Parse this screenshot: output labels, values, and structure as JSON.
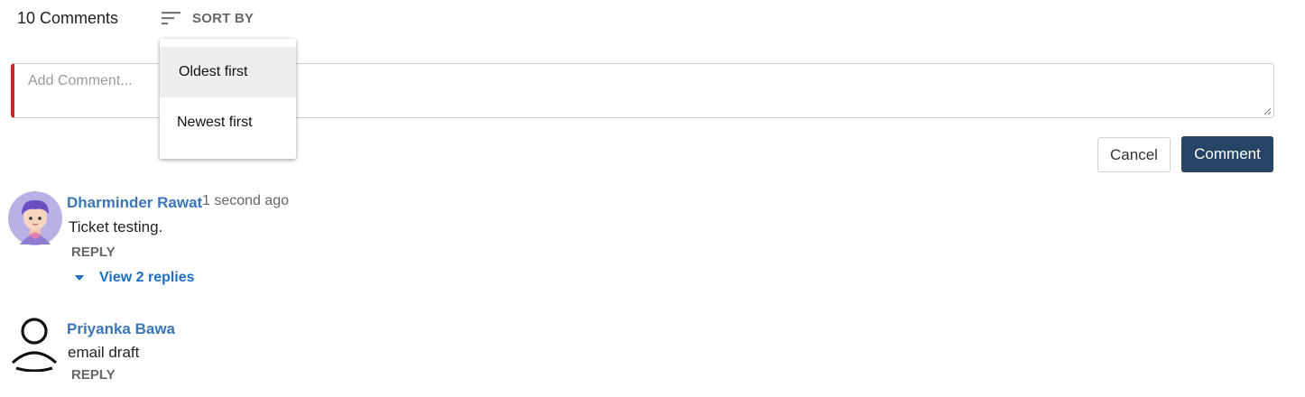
{
  "header": {
    "count_label": "10 Comments",
    "sort_label": "SORT BY",
    "sort_icon": "sort-lines-icon"
  },
  "sort_menu": {
    "options": [
      "Oldest first",
      "Newest first"
    ],
    "selected": "Oldest first"
  },
  "composer": {
    "placeholder": "Add Comment...",
    "cancel_label": "Cancel",
    "submit_label": "Comment"
  },
  "comments": [
    {
      "author": "Dharminder Rawat",
      "time": "1 second ago",
      "text": "Ticket testing.",
      "reply_label": "REPLY",
      "view_replies_label": "View 2 replies",
      "avatar": "cartoon-boy-avatar"
    },
    {
      "author": "Priyanka Bawa",
      "text": "email draft",
      "reply_label": "REPLY",
      "avatar": "default-person-icon"
    }
  ],
  "colors": {
    "accent_blue": "#3b76b8",
    "link_blue": "#1a6fc4",
    "submit_bg": "#264466",
    "error_border": "#c62828"
  }
}
